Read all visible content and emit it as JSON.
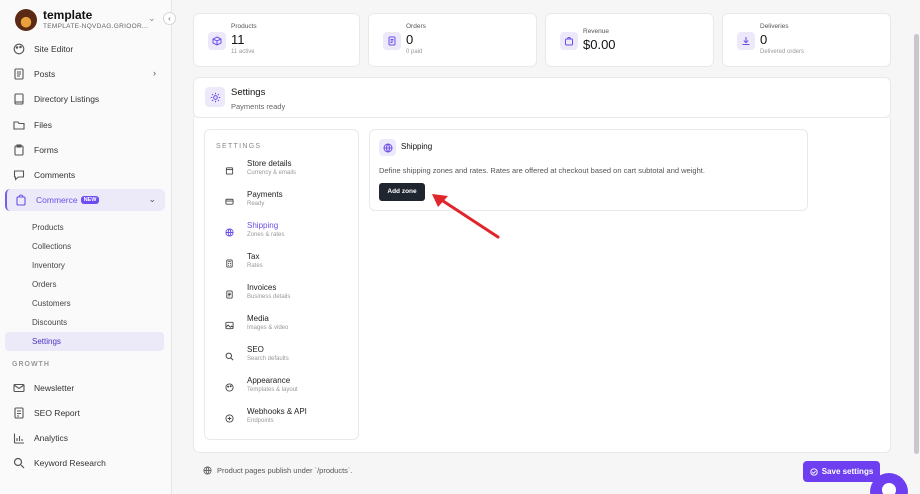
{
  "workspace": {
    "name": "template",
    "subtitle": "TEMPLATE-NQVDAG.GRIOOR..."
  },
  "sidebar": {
    "items": [
      {
        "label": "Site Editor",
        "icon": "palette-icon"
      },
      {
        "label": "Posts",
        "icon": "document-icon"
      },
      {
        "label": "Directory Listings",
        "icon": "book-icon"
      },
      {
        "label": "Files",
        "icon": "folder-icon"
      },
      {
        "label": "Forms",
        "icon": "clipboard-icon"
      },
      {
        "label": "Comments",
        "icon": "chat-icon"
      },
      {
        "label": "Commerce",
        "icon": "bag-icon",
        "badge": "NEW"
      }
    ],
    "commerce_sub": [
      "Products",
      "Collections",
      "Inventory",
      "Orders",
      "Customers",
      "Discounts",
      "Settings"
    ],
    "growth_heading": "GROWTH",
    "growth_items": [
      {
        "label": "Newsletter",
        "icon": "mail-icon"
      },
      {
        "label": "SEO Report",
        "icon": "report-icon"
      },
      {
        "label": "Analytics",
        "icon": "chart-icon"
      },
      {
        "label": "Keyword Research",
        "icon": "search-icon"
      }
    ]
  },
  "stats": [
    {
      "label": "Products",
      "value": "11",
      "sub": "11 active",
      "icon": "box-icon"
    },
    {
      "label": "Orders",
      "value": "0",
      "sub": "0 paid",
      "icon": "receipt-icon"
    },
    {
      "label": "Revenue",
      "value": "$0.00",
      "sub": "",
      "icon": "bag-icon"
    },
    {
      "label": "Deliveries",
      "value": "0",
      "sub": "Delivered orders",
      "icon": "download-icon"
    }
  ],
  "settings": {
    "title": "Settings",
    "subtitle": "Payments ready"
  },
  "settings_nav": {
    "heading": "SETTINGS",
    "items": [
      {
        "label": "Store details",
        "sub": "Currency & emails",
        "icon": "store-icon"
      },
      {
        "label": "Payments",
        "sub": "Ready",
        "icon": "card-icon"
      },
      {
        "label": "Shipping",
        "sub": "Zones & rates",
        "icon": "globe-icon"
      },
      {
        "label": "Tax",
        "sub": "Rates",
        "icon": "calculator-icon"
      },
      {
        "label": "Invoices",
        "sub": "Business details",
        "icon": "invoice-icon"
      },
      {
        "label": "Media",
        "sub": "Images & video",
        "icon": "image-icon"
      },
      {
        "label": "SEO",
        "sub": "Search defaults",
        "icon": "search-icon"
      },
      {
        "label": "Appearance",
        "sub": "Templates & layout",
        "icon": "palette-icon"
      },
      {
        "label": "Webhooks & API",
        "sub": "Endpoints",
        "icon": "webhook-icon"
      }
    ]
  },
  "shipping": {
    "title": "Shipping",
    "description": "Define shipping zones and rates. Rates are offered at checkout based on cart subtotal and weight.",
    "add_zone_label": "Add zone"
  },
  "footer": {
    "note": "Product pages publish under `/products`.",
    "save_label": "Save settings"
  },
  "colors": {
    "accent": "#6d3ff0",
    "annotation_arrow": "#e0252b",
    "dark_button": "#1f2630"
  }
}
